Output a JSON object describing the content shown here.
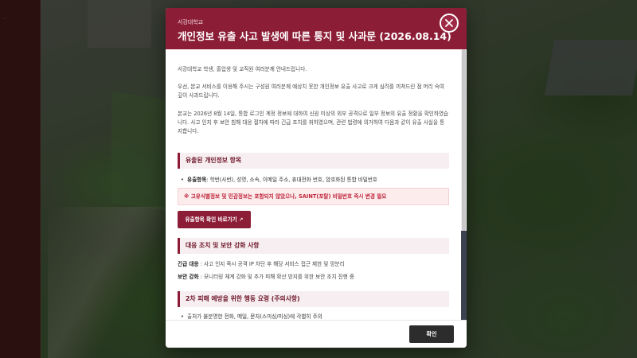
{
  "background": {
    "sidebar_text": "...",
    "colors": {
      "brand": "#8c1d36",
      "sidebar": "#3a1616"
    }
  },
  "modal": {
    "org": "서강대학교",
    "title": "개인정보 유출 사고 발생에 따른 통지 및 사과문 (2026.08.14)",
    "close_icon": "close-icon",
    "intro": "서강대학교 학생, 졸업생 및 교직원 여러분께 안내드립니다.",
    "apology": "우선, 본교 서비스를 이용해 주시는 구성원 여러분께 예상치 못한 개인정보 유출 사고로 크게 심려를 끼쳐드린 점 머리 숙여 깊이 사과드립니다.",
    "description": "본교는 2026년 8월 14일, 통합 로그인 계정 정보에 대하여 신원 미상의 외부 공격으로 일부 정보의 유출 정황을 확인하였습니다. 사고 인지 후 보안 침해 대응 절차에 따라 긴급 조치를 취하였으며, 관련 법령에 의거하여 다음과 같이 유출 사실을 통지합니다.",
    "section_leaked": {
      "heading": "유출된 개인정보 항목",
      "item_label": "유출항목",
      "item_value": ": 학번(사번), 성명, 소속, 이메일 주소, 휴대전화 번호, 암호화된 통합 비밀번호",
      "notice": "※ 고유식별정보 및 민감정보는 포함되지 않았으나, SAINT(포탈) 비밀번호 즉시 변경 필요",
      "link_button": "유출항목 확인 바로가기 ↗"
    },
    "section_response": {
      "heading": "대응 조치 및 보안 강화 사항",
      "emergency_label": "긴급 대응",
      "emergency_value": " : 사고 인지 즉시 공격 IP 차단 후 해당 서비스 접근 제한 및 망분리",
      "security_label": "보안 강화",
      "security_value": " : 모니터링 체계 강화 및 추가 피해 확산 방지를 위한 보안 조치 진행 중"
    },
    "section_prevention": {
      "heading": "2차 피해 예방을 위한 행동 요령 (주의사항)",
      "item1": "출처가 불분명한 전화, 메일, 문자(스미싱/피싱)에 각별히 주의"
    },
    "confirm_button": "확인"
  }
}
